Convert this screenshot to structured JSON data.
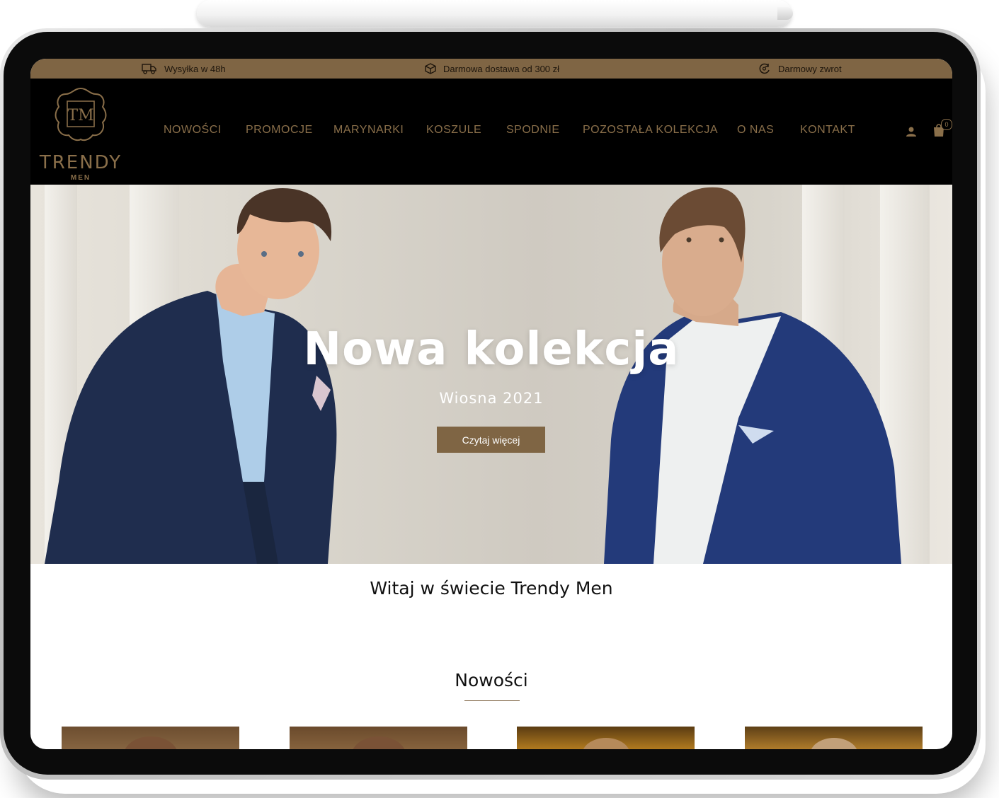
{
  "infobar": {
    "shipping": "Wysyłka w 48h",
    "free_delivery": "Darmowa dostawa od 300 zł",
    "free_return": "Darmowy zwrot"
  },
  "logo": {
    "monogram": "TM",
    "name": "TRENDY",
    "sub": "MEN"
  },
  "nav": {
    "items": [
      "NOWOŚCI",
      "PROMOCJE",
      "MARYNARKI",
      "KOSZULE",
      "SPODNIE",
      "POZOSTAŁA KOLEKCJA",
      "O NAS",
      "KONTAKT"
    ]
  },
  "cart": {
    "count": "0"
  },
  "hero": {
    "title": "Nowa kolekcja",
    "subtitle": "Wiosna 2021",
    "button": "Czytaj więcej"
  },
  "welcome": {
    "title": "Witaj w świecie Trendy Men"
  },
  "new_section": {
    "title": "Nowości"
  },
  "colors": {
    "brand_gold": "#7f6544",
    "header_bg": "#000000",
    "navy_jacket": "#1f2d4e"
  },
  "icons": [
    "truck-icon",
    "box-icon",
    "return-icon",
    "user-icon",
    "cart-icon"
  ]
}
